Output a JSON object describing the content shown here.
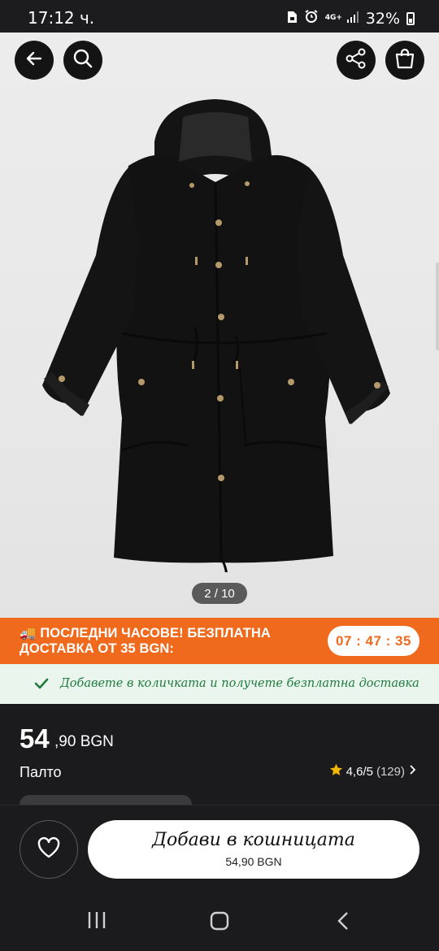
{
  "status_bar": {
    "time": "17:12 ч.",
    "network": "4G+",
    "battery": "32%"
  },
  "gallery": {
    "page_indicator": "2 / 10",
    "icons": {
      "back": "arrow-left-icon",
      "search": "search-icon",
      "share": "share-icon",
      "bag": "shopping-bag-icon"
    }
  },
  "promo": {
    "emoji": "🚚",
    "text": "ПОСЛЕДНИ ЧАСОВЕ! БЕЗПЛАТНА ДОСТАВКА ОТ 35 BGN:",
    "timer": "07 : 47 : 35",
    "color": "#f06a1d"
  },
  "free_shipping": {
    "text": "Добавете в количката и получете безплатна доставка",
    "color": "#1f7a3e"
  },
  "product": {
    "price_main": "54",
    "price_rest": ",90 BGN",
    "name": "Палто",
    "rating": "4,6/5",
    "rating_count": "(129)"
  },
  "actions": {
    "add_to_cart": "Добави в кошницата",
    "add_to_cart_price": "54,90 BGN"
  }
}
